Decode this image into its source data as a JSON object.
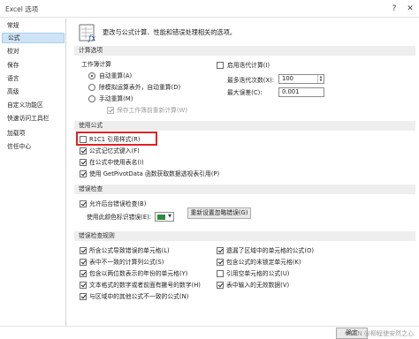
{
  "window": {
    "title": "Excel 选项",
    "help": "?",
    "close": "✕"
  },
  "sidebar": {
    "items": [
      {
        "label": "常规",
        "active": false
      },
      {
        "label": "公式",
        "active": true
      },
      {
        "label": "校对",
        "active": false
      },
      {
        "label": "保存",
        "active": false
      },
      {
        "label": "语言",
        "active": false
      },
      {
        "label": "高级",
        "active": false
      },
      {
        "label": "自定义功能区",
        "active": false
      },
      {
        "label": "快速访问工具栏",
        "active": false
      },
      {
        "label": "加载项",
        "active": false
      },
      {
        "label": "信任中心",
        "active": false
      }
    ]
  },
  "main": {
    "intro": "更改与公式计算、性能和错误处理相关的选项。",
    "calc": {
      "header": "计算选项",
      "workbook_label": "工作簿计算",
      "auto": "自动重算(A)",
      "auto_except": "除模拟运算表外，自动重算(D)",
      "manual": "手动重算(M)",
      "recalc_before_save": "保存工作簿前重新计算(W)",
      "iterative": "启用迭代计算(I)",
      "max_iter_label": "最多迭代次数(X):",
      "max_iter_value": "100",
      "max_change_label": "最大误差(C):",
      "max_change_value": "0.001"
    },
    "formulas": {
      "header": "使用公式",
      "r1c1": "R1C1 引用样式(R)",
      "autocomplete": "公式记忆式键入(F)",
      "table_names": "在公式中使用表名(I)",
      "getpivot": "使用 GetPivotData 函数获取数据透视表引用(P)"
    },
    "error_check": {
      "header": "错误检查",
      "background": "允许后台错误检查(B)",
      "color_label": "使用此颜色标识错误(E):",
      "reset_button": "重新设置忽略错误(G)"
    },
    "rules": {
      "header": "错误检查规则",
      "left": [
        "所含公式导致错误的单元格(L)",
        "表中不一致的计算列公式(S)",
        "包含以两位数表示的年份的单元格(Y)",
        "文本格式的数字或者前面有撇号的数字(H)",
        "与区域中的其他公式不一致的公式(N)"
      ],
      "right": [
        "遗漏了区域中的单元格的公式(O)",
        "包含公式的未锁定单元格(K)",
        "引用空单元格的公式(U)",
        "表中输入的无效数据(V)"
      ]
    }
  },
  "footer": {
    "ok": "确定",
    "watermark": "CSDN @柳程使安然之心"
  },
  "colors": {
    "highlight": "#e12222",
    "active_nav": "#cfe3f7",
    "error_color": "#2e8b3c"
  }
}
